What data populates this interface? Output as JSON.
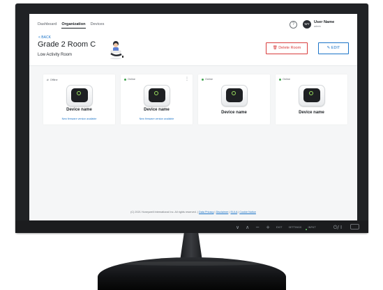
{
  "nav": {
    "tabs": [
      "Dashboard",
      "Organization",
      "Devices"
    ],
    "active_index": 1
  },
  "user": {
    "initials": "WY",
    "name": "User Name",
    "role": "admin"
  },
  "page": {
    "back_label": "< BACK",
    "title": "Grade 2 Room C",
    "subtitle": "Low Activity Room",
    "delete_label": "Delete Room",
    "edit_label": "EDIT"
  },
  "devices": [
    {
      "status": "Offline",
      "name": "Device name",
      "firmware_note": "New firmware version available"
    },
    {
      "status": "Online",
      "name": "Device name",
      "firmware_note": "New firmware version available"
    },
    {
      "status": "Online",
      "name": "Device name",
      "firmware_note": ""
    },
    {
      "status": "Online",
      "name": "Device name",
      "firmware_note": ""
    }
  ],
  "footer": {
    "copyright": "(C) 2021 Honeywell International Inc. All rights reserved. |",
    "links": [
      "Data Privacy",
      "Disclaimer",
      "EULA",
      "Cookie Notice"
    ]
  },
  "monitor_controls": {
    "symbols": [
      "∨",
      "∧",
      "−",
      "+"
    ],
    "buttons": [
      "EXIT",
      "SETTINGS",
      "INPUT"
    ],
    "power_label": "⏻/ I"
  },
  "colors": {
    "accent": "#1a73c8",
    "danger": "#d93c3c",
    "online": "#3fa34d"
  }
}
